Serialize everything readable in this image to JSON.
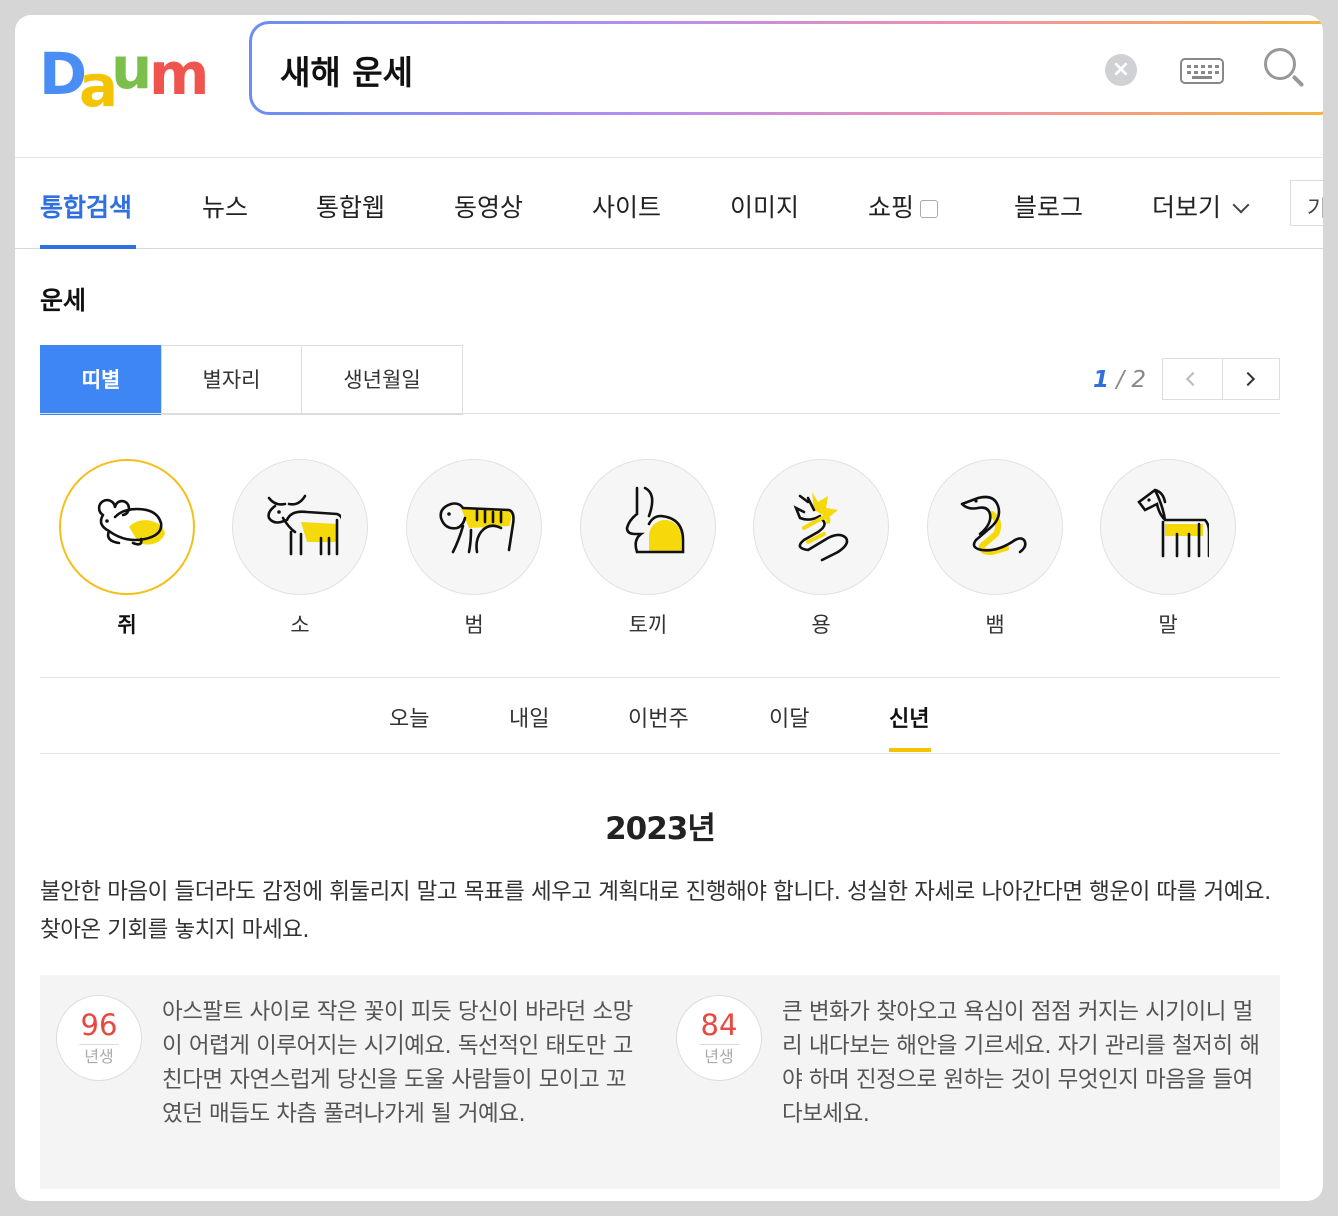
{
  "logo": {
    "text": "Daum",
    "letters": [
      "D",
      "a",
      "u",
      "m"
    ],
    "colors": [
      "#4a8df5",
      "#f5c400",
      "#7cc04b",
      "#f0544f"
    ]
  },
  "search": {
    "query": "새해 운세",
    "clear_icon": "close-icon",
    "keyboard_icon": "keyboard-icon",
    "search_icon": "search-icon"
  },
  "tabs": [
    {
      "label": "통합검색",
      "active": true
    },
    {
      "label": "뉴스"
    },
    {
      "label": "통합웹"
    },
    {
      "label": "동영상"
    },
    {
      "label": "사이트"
    },
    {
      "label": "이미지"
    },
    {
      "label": "쇼핑"
    },
    {
      "label": "블로그"
    },
    {
      "label": "더보기"
    }
  ],
  "period_filter": "기간",
  "section": {
    "title": "운세",
    "subtabs": [
      "띠별",
      "별자리",
      "생년월일"
    ],
    "pager": {
      "current": "1",
      "total": "2"
    }
  },
  "zodiac": [
    {
      "label": "쥐",
      "icon": "rat-icon",
      "selected": true
    },
    {
      "label": "소",
      "icon": "ox-icon"
    },
    {
      "label": "범",
      "icon": "tiger-icon"
    },
    {
      "label": "토끼",
      "icon": "rabbit-icon"
    },
    {
      "label": "용",
      "icon": "dragon-icon"
    },
    {
      "label": "뱀",
      "icon": "snake-icon"
    },
    {
      "label": "말",
      "icon": "horse-icon"
    }
  ],
  "period_tabs": [
    "오늘",
    "내일",
    "이번주",
    "이달",
    "신년"
  ],
  "fortune": {
    "year": "2023년",
    "summary": "불안한 마음이 들더라도 감정에 휘둘리지 말고 목표를 세우고 계획대로 진행해야 합니다. 성실한 자세로 나아간다면 행운이 따를 거예요. 찾아온 기회를 놓치지 마세요.",
    "by_year": [
      {
        "year": "96",
        "unit": "년생",
        "text": "아스팔트 사이로 작은 꽃이 피듯 당신이 바라던 소망이 어렵게 이루어지는 시기예요. 독선적인 태도만 고친다면 자연스럽게 당신을 도울 사람들이 모이고 꼬였던 매듭도 차츰 풀려나가게 될 거예요."
      },
      {
        "year": "84",
        "unit": "년생",
        "text": "큰 변화가 찾아오고 욕심이 점점 커지는 시기이니 멀리 내다보는 해안을 기르세요. 자기 관리를 철저히 해야 하며 진정으로 원하는 것이 무엇인지 마음을 들여다보세요."
      }
    ]
  },
  "colors": {
    "accent": "#2f6fe0",
    "subtab_active": "#3f86f5",
    "highlight": "#f5c400",
    "age_number": "#e8483f"
  }
}
